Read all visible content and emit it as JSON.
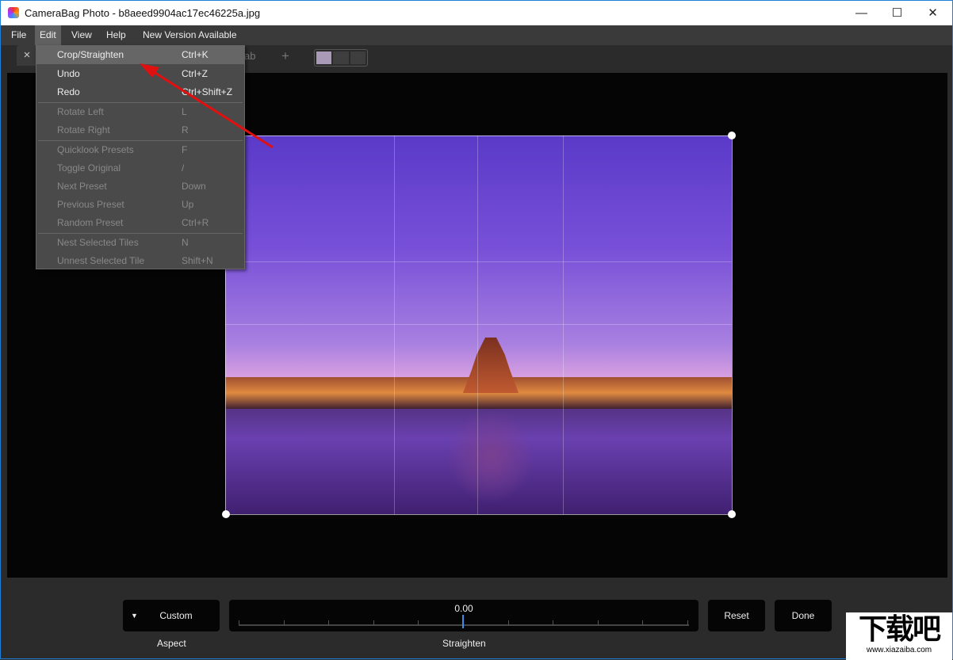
{
  "window": {
    "title": "CameraBag Photo - b8aeed9904ac17ec46225a.jpg",
    "minimize": "—",
    "maximize": "☐",
    "close": "✕"
  },
  "menubar": [
    "File",
    "Edit",
    "View",
    "Help",
    "New Version Available"
  ],
  "tabs": {
    "close": "×",
    "partial_label": "ab",
    "add": "+"
  },
  "edit_menu": [
    {
      "label": "Crop/Straighten",
      "shortcut": "Ctrl+K",
      "enabled": true,
      "highlighted": true
    },
    {
      "label": "Undo",
      "shortcut": "Ctrl+Z",
      "enabled": true
    },
    {
      "label": "Redo",
      "shortcut": "Ctrl+Shift+Z",
      "enabled": true
    },
    {
      "label": "Rotate Left",
      "shortcut": "L",
      "enabled": false
    },
    {
      "label": "Rotate Right",
      "shortcut": "R",
      "enabled": false
    },
    {
      "label": "Quicklook Presets",
      "shortcut": "F",
      "enabled": false
    },
    {
      "label": "Toggle Original",
      "shortcut": "/",
      "enabled": false
    },
    {
      "label": "Next Preset",
      "shortcut": "Down",
      "enabled": false
    },
    {
      "label": "Previous Preset",
      "shortcut": "Up",
      "enabled": false
    },
    {
      "label": "Random Preset",
      "shortcut": "Ctrl+R",
      "enabled": false
    },
    {
      "label": "Nest Selected Tiles",
      "shortcut": "N",
      "enabled": false
    },
    {
      "label": "Unnest Selected Tile",
      "shortcut": "Shift+N",
      "enabled": false
    }
  ],
  "crop": {
    "aspect_value": "Custom",
    "aspect_label": "Aspect",
    "straighten_value": "0.00",
    "straighten_label": "Straighten",
    "reset": "Reset",
    "done": "Done"
  },
  "watermark": {
    "big": "下载吧",
    "small": "www.xiazaiba.com"
  }
}
